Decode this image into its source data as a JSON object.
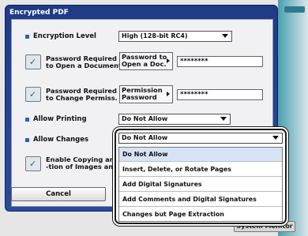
{
  "window": {
    "title": "Encrypted PDF"
  },
  "encryption_level": {
    "label": "Encryption Level",
    "value": "High (128-bit RC4)"
  },
  "open_password": {
    "label_line1": "Password Required",
    "label_line2": "to Open a Document",
    "button_line1": "Password to",
    "button_line2": "Open a Doc.",
    "value": "********"
  },
  "change_password": {
    "label_line1": "Password Required",
    "label_line2": "to Change Permiss.",
    "button_line1": "Permission",
    "button_line2": "Password",
    "value": "********"
  },
  "allow_printing": {
    "label": "Allow Printing",
    "value": "Do Not Allow"
  },
  "allow_changes": {
    "label": "Allow Changes",
    "value": "Do Not Allow"
  },
  "enable_copying": {
    "label_line1": "Enable Copying and",
    "label_line2": "-tion of Images and"
  },
  "cancel_label": "Cancel",
  "system_monitor_label": "System Monitor",
  "changes_dropdown": {
    "selected": "Do Not Allow",
    "options": [
      "Do Not Allow",
      "Insert, Delete, or Rotate Pages",
      "Add Digital Signatures",
      "Add Comments and Digital Signatures",
      "Changes but Page Extraction"
    ]
  },
  "colors": {
    "title_bar": "#1f3b86",
    "bullet": "#2a5fcf",
    "check": "#1b7a2a",
    "selected_option": "#d8e4f6"
  }
}
